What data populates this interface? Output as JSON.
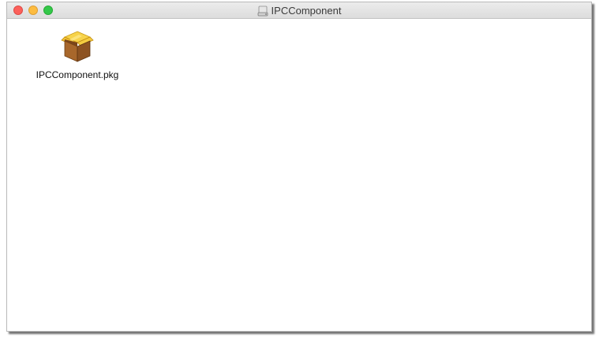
{
  "window": {
    "title": "IPCComponent",
    "title_icon": "disk-image-icon"
  },
  "traffic_lights": {
    "close_color": "#fc605b",
    "minimize_color": "#fdbc40",
    "zoom_color": "#34c84a"
  },
  "files": [
    {
      "name": "IPCComponent.pkg",
      "icon": "package-icon"
    }
  ]
}
